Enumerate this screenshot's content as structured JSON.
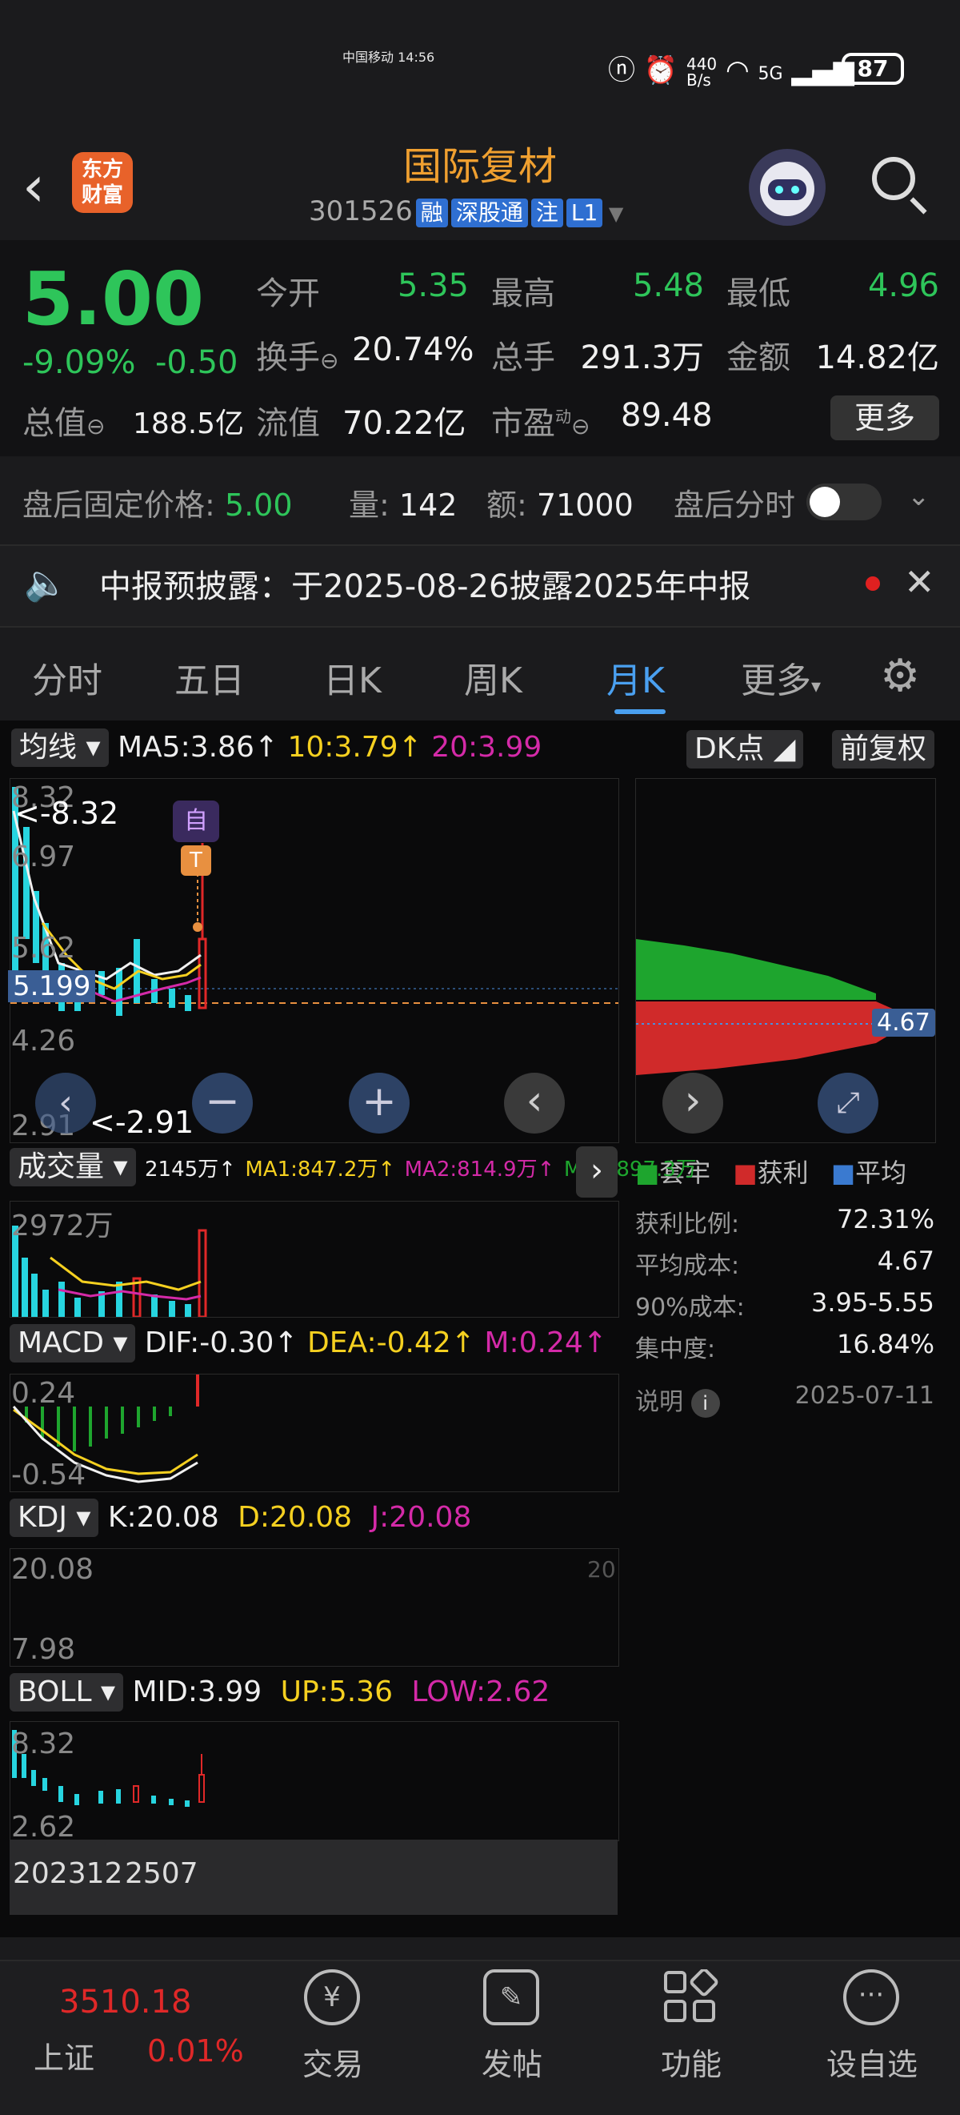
{
  "status_bar": {
    "carrier": "中国移动",
    "time": "14:56",
    "net_speed": "440\nB/s",
    "signal": "5G",
    "battery": "87"
  },
  "header": {
    "title": "国际复材",
    "code": "301526",
    "tags": [
      "融",
      "深股通",
      "注",
      "L1"
    ],
    "logo_text": "东方\n财富"
  },
  "quote": {
    "price": "5.00",
    "change_pct": "-9.09%",
    "change": "-0.50",
    "fields": [
      {
        "label": "今开",
        "value": "5.35"
      },
      {
        "label": "最高",
        "value": "5.48"
      },
      {
        "label": "最低",
        "value": "4.96"
      },
      {
        "label": "换手",
        "value": "20.74%"
      },
      {
        "label": "总手",
        "value": "291.3万"
      },
      {
        "label": "金额",
        "value": "14.82亿"
      },
      {
        "label": "总值",
        "value": "188.5亿"
      },
      {
        "label": "流值",
        "value": "70.22亿"
      },
      {
        "label": "市盈",
        "value": "89.48"
      }
    ],
    "more_label": "更多",
    "pe_sup": "动"
  },
  "after_hours": {
    "label": "盘后固定价格:",
    "price": "5.00",
    "vol_label": "量:",
    "vol": "142",
    "amt_label": "额:",
    "amt": "71000",
    "toggle_label": "盘后分时"
  },
  "notice": {
    "text": "中报预披露：于2025-08-26披露2025年中报"
  },
  "tabs": [
    "分时",
    "五日",
    "日K",
    "周K",
    "月K",
    "更多"
  ],
  "active_tab": "月K",
  "kline": {
    "ma_select": "均线",
    "ma5": "MA5:3.86↑",
    "ma10": "10:3.79↑",
    "ma20": "20:3.99",
    "dk_label": "DK点",
    "fq_label": "前复权",
    "y_labels": [
      "8.32",
      "6.97",
      "5.62",
      "4.26",
      "2.91"
    ],
    "hi_note": "<-8.32",
    "lo_note": "<-2.91",
    "cur_line": "5.199",
    "marker_zi": "自",
    "marker_t": "T"
  },
  "chip": {
    "avg_label": "4.67",
    "legend": [
      "套牢",
      "获利",
      "平均"
    ],
    "rows": [
      {
        "label": "获利比例:",
        "value": "72.31%"
      },
      {
        "label": "平均成本:",
        "value": "4.67"
      },
      {
        "label": "90%成本:",
        "value": "3.95-5.55"
      },
      {
        "label": "集中度:",
        "value": "16.84%"
      }
    ],
    "note_label": "说明",
    "date": "2025-07-11"
  },
  "volume": {
    "select": "成交量",
    "vals": "2145万↑",
    "ma1": "MA1:847.2万↑",
    "ma2": "MA2:814.9万↑",
    "ma3": "MA3:897.3万",
    "top": "2972万"
  },
  "macd": {
    "select": "MACD",
    "dif": "DIF:-0.30↑",
    "dea": "DEA:-0.42↑",
    "m": "M:0.24↑",
    "top": "0.24",
    "bottom": "-0.54"
  },
  "kdj": {
    "select": "KDJ",
    "k": "K:20.08",
    "d": "D:20.08",
    "j": "J:20.08",
    "top": "20.08",
    "bottom": "7.98",
    "right": "20"
  },
  "boll": {
    "select": "BOLL",
    "mid": "MID:3.99",
    "up": "UP:5.36",
    "low": "LOW:2.62",
    "top": "8.32",
    "bottom": "2.62"
  },
  "x_axis": {
    "start": "202312",
    "end": "2507"
  },
  "bottom_nav": {
    "index_value": "3510.18",
    "index_name": "上证",
    "index_chg": "0.01%",
    "items": [
      "交易",
      "发帖",
      "功能",
      "设自选"
    ]
  }
}
